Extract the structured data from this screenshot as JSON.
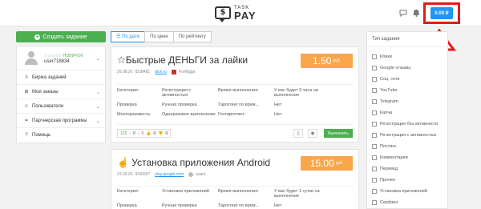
{
  "header": {
    "logo_icon_text": "$",
    "logo_top": "TASK",
    "logo_bottom": "PAY",
    "chat_icon": "chat-icon",
    "bell_icon": "bell-icon",
    "balance": "0.00 ₽",
    "highlight_color": "#e21b1b"
  },
  "sidebar": {
    "create_label": "Создать задание",
    "rank": "☆☆☆☆☆ НОВИЧОК",
    "username": "user718834",
    "items": [
      {
        "label": "Биржа заданий",
        "icon": "list-icon",
        "arrow": ""
      },
      {
        "label": "Мои заказы",
        "icon": "cart-icon",
        "arrow": "⌄"
      },
      {
        "label": "Пользователи",
        "icon": "users-icon",
        "arrow": "⌄"
      },
      {
        "label": "Партнерская программа",
        "icon": "handshake-icon",
        "arrow": "⌄"
      },
      {
        "label": "Помощь",
        "icon": "help-icon",
        "arrow": ""
      }
    ]
  },
  "sort_tabs": [
    "По дате",
    "По цене",
    "По рейтингу"
  ],
  "tasks": [
    {
      "title": "☆Быстрые ДЕНЬГИ за лайки",
      "date": "26.08.20",
      "id": "ID38481",
      "site": "dick.ru",
      "author": "ForNigga",
      "price": "1.50",
      "currency": "руб.",
      "rows": [
        {
          "l1": "Категория:",
          "v1": "Регистрация с активностью",
          "l2": "Время выполнения:",
          "v2": "У вас будет 3 часа на выполнение"
        },
        {
          "l1": "Проверка",
          "v1": "Ручная проверка",
          "l2": "Таргетинг по врем...",
          "v2": "Нет"
        },
        {
          "l1": "Многоразовость:",
          "v1": "Одноразовое выполнение",
          "l2": "Геотаргетинг:",
          "v2": "Нет"
        }
      ],
      "votes": {
        "count": "125",
        "neutral": "0",
        "minus": "0",
        "like": "0",
        "dislike": "0"
      },
      "execute": "Выполнить"
    },
    {
      "title": "☝ Установка приложения Android",
      "date": "23.09.20",
      "id": "ID40067",
      "site": "play.google.com",
      "author": "soant",
      "price": "15.00",
      "currency": "руб.",
      "rows": [
        {
          "l1": "Категория:",
          "v1": "Установка приложений",
          "l2": "Время выполнения:",
          "v2": "У вас будет 1 сутки на выполнение"
        },
        {
          "l1": "Проверка",
          "v1": "Ручная проверка",
          "l2": "Таргетинг по врем...",
          "v2": "Нет"
        }
      ]
    }
  ],
  "filter": {
    "title": "Тип задания",
    "options": [
      "Клики",
      "Google отзывы",
      "Соц. сети",
      "YouTube",
      "Telegram",
      "Капча",
      "Регистрация без активности",
      "Регистрация с активностью",
      "Постинг",
      "Комментарии",
      "Перевод",
      "Прочее",
      "Установка приложений",
      "Серфинг"
    ]
  }
}
